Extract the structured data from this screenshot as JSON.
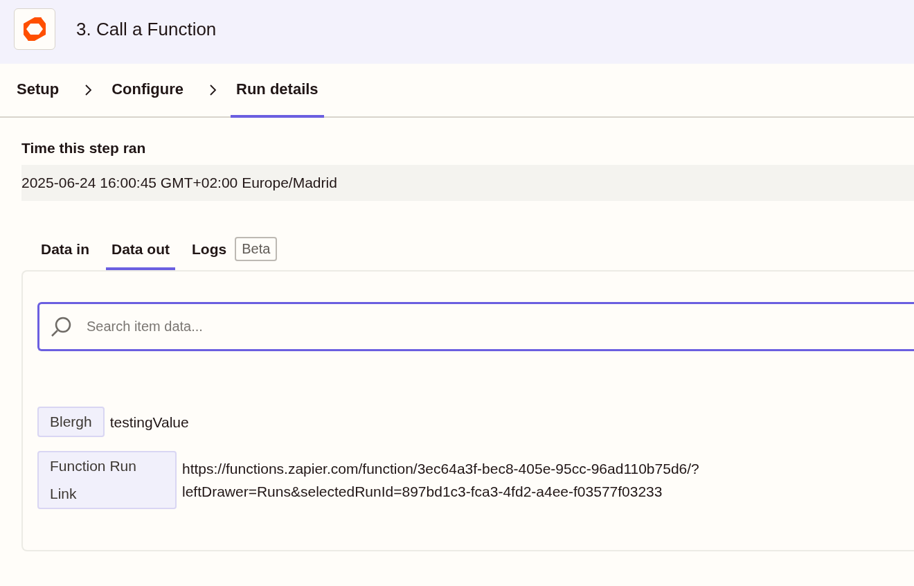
{
  "header": {
    "title": "3. Call a Function"
  },
  "steps": [
    {
      "label": "Setup",
      "selected": false
    },
    {
      "label": "Configure",
      "selected": false
    },
    {
      "label": "Run details",
      "selected": true
    }
  ],
  "time_section": {
    "label": "Time this step ran",
    "value": "2025-06-24 16:00:45 GMT+02:00 Europe/Madrid"
  },
  "data_tabs": [
    {
      "label": "Data in",
      "selected": false
    },
    {
      "label": "Data out",
      "selected": true
    },
    {
      "label": "Logs",
      "selected": false,
      "badge": "Beta"
    }
  ],
  "search": {
    "placeholder": "Search item data..."
  },
  "items": [
    {
      "key": "Blergh",
      "value": "testingValue"
    },
    {
      "key": "Function Run Link",
      "value": "https://functions.zapier.com/function/3ec64a3f-bec8-405e-95cc-96ad110b75d6/?leftDrawer=Runs&selectedRunId=897bd1c3-fca3-4fd2-a4ee-f03577f03233"
    }
  ]
}
